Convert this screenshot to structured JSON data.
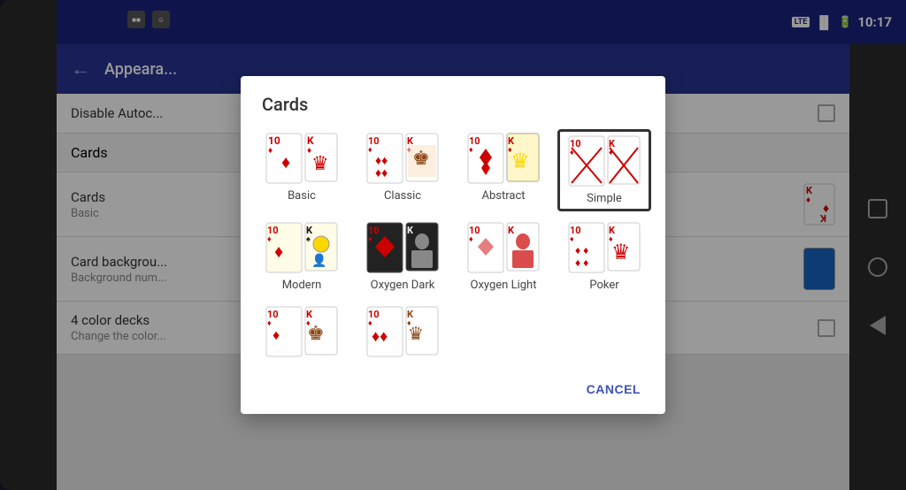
{
  "status_bar": {
    "time": "10:17",
    "lte": "LTE",
    "battery_icon": "🔋"
  },
  "toolbar": {
    "title": "Appeara...",
    "back_label": "←"
  },
  "settings": {
    "items": [
      {
        "title": "Disable Autoc...",
        "subtitle": "",
        "has_checkbox": true
      },
      {
        "title": "Cards",
        "subtitle": "",
        "is_section": true,
        "color": "blue"
      },
      {
        "title": "Cards",
        "subtitle": "Basic",
        "has_card_preview": true
      },
      {
        "title": "Card backgrou...",
        "subtitle": "Background num...",
        "has_card_back": true
      },
      {
        "title": "4 color decks",
        "subtitle": "Change the color...",
        "has_checkbox": true
      }
    ]
  },
  "dialog": {
    "title": "Cards",
    "cancel_label": "CANCEL",
    "options": [
      {
        "id": "basic",
        "label": "Basic",
        "selected": false
      },
      {
        "id": "classic",
        "label": "Classic",
        "selected": false
      },
      {
        "id": "abstract",
        "label": "Abstract",
        "selected": false
      },
      {
        "id": "simple",
        "label": "Simple",
        "selected": true
      },
      {
        "id": "modern",
        "label": "Modern",
        "selected": false
      },
      {
        "id": "oxygen_dark",
        "label": "Oxygen Dark",
        "selected": false
      },
      {
        "id": "oxygen_light",
        "label": "Oxygen Light",
        "selected": false
      },
      {
        "id": "poker",
        "label": "Poker",
        "selected": false
      },
      {
        "id": "row2col1",
        "label": "",
        "selected": false
      },
      {
        "id": "row2col2",
        "label": "",
        "selected": false
      }
    ]
  }
}
